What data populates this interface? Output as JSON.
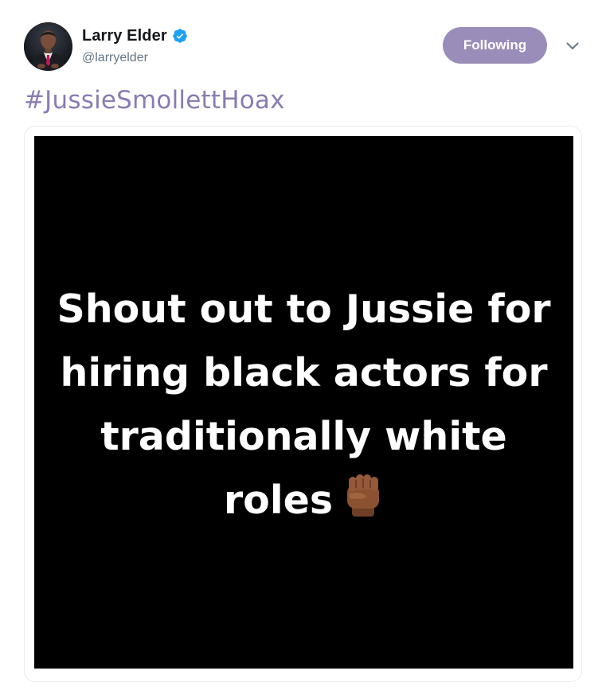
{
  "tweet": {
    "author": {
      "display_name": "Larry Elder",
      "handle": "@larryelder",
      "verified": true,
      "avatar_icon": "profile-photo"
    },
    "follow_button_label": "Following",
    "menu_icon": "chevron-down-icon",
    "text": "#JussieSmollettHoax",
    "media": {
      "caption_lines": [
        "Shout out to Jussie for",
        "hiring black actors for",
        "traditionally white",
        "roles"
      ],
      "emoji": "raised-fist-medium-dark-skin-tone"
    }
  },
  "colors": {
    "follow_button_bg": "#9a8db9",
    "hashtag": "#8a7cb3",
    "verified_badge": "#1da1f2",
    "handle_text": "#657786"
  }
}
